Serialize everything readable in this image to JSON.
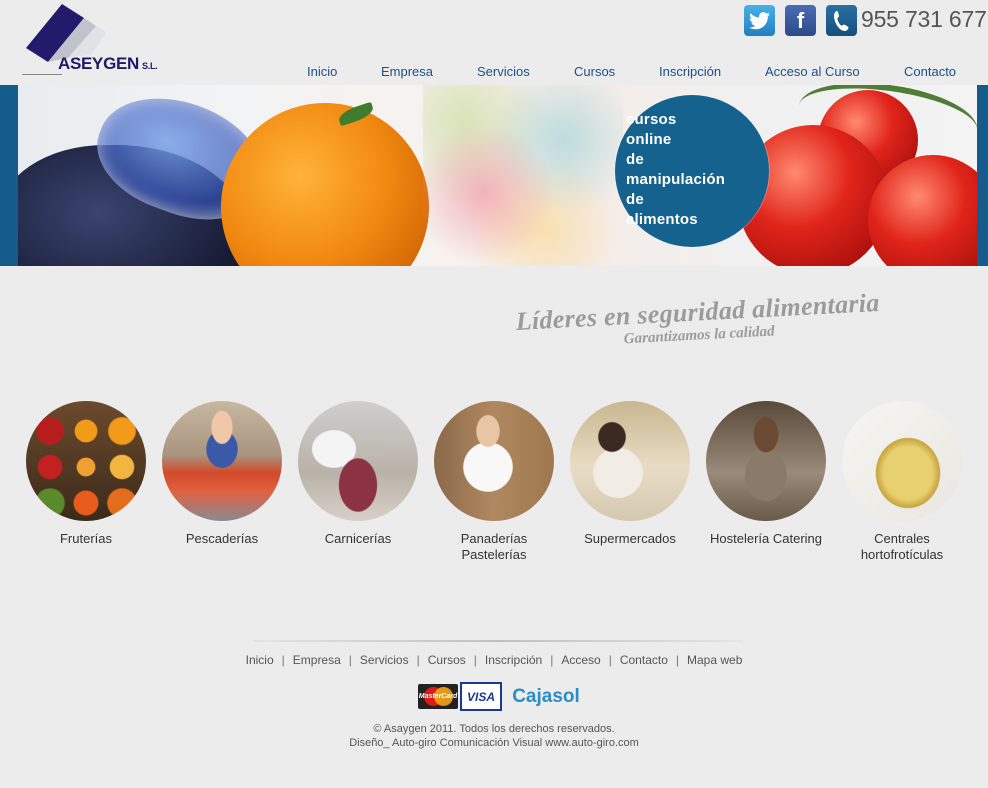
{
  "header": {
    "logo_text": "ASEYGEN",
    "logo_suffix": "S.L.",
    "phone": "955 731 677",
    "social": [
      {
        "name": "twitter",
        "icon": "twitter-icon"
      },
      {
        "name": "facebook",
        "icon": "facebook-icon"
      },
      {
        "name": "phone",
        "icon": "phone-icon"
      }
    ]
  },
  "nav": {
    "items": [
      {
        "label": "Inicio"
      },
      {
        "label": "Empresa"
      },
      {
        "label": "Servicios"
      },
      {
        "label": "Cursos"
      },
      {
        "label": "Inscripción"
      },
      {
        "label": "Acceso al Curso"
      },
      {
        "label": "Contacto"
      }
    ]
  },
  "banner": {
    "badge_lines": [
      "cursos",
      "online",
      "de",
      "manipulación",
      "de",
      "alimentos"
    ]
  },
  "tagline": {
    "main": "Líderes en seguridad alimentaria",
    "sub": "Garantizamos la calidad"
  },
  "categories": [
    {
      "label": "Fruterías"
    },
    {
      "label": "Pescaderías"
    },
    {
      "label": "Carnicerías"
    },
    {
      "label": "Panaderías Pastelerías"
    },
    {
      "label": "Supermercados"
    },
    {
      "label": "Hostelería Catering"
    },
    {
      "label": "Centrales hortofrotículas"
    }
  ],
  "footer": {
    "nav": [
      "Inicio",
      "Empresa",
      "Servicios",
      "Cursos",
      "Inscripción",
      "Acceso",
      "Contacto",
      "Mapa web"
    ],
    "separator": "|",
    "payments": {
      "mastercard": "MasterCard",
      "visa": "VISA",
      "bank": "Cajasol"
    },
    "copyright": "© Asaygen 2011. Todos los derechos reservados.",
    "credits": "Diseño_ Auto-giro Comunicación Visual www.auto-giro.com"
  },
  "colors": {
    "background": "#ececec",
    "nav_link": "#1d4f8a",
    "banner_blue": "#15628f",
    "logo_navy": "#1e1a66"
  }
}
